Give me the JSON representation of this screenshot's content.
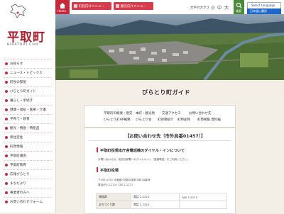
{
  "sidebar": {
    "logo_text": "平取町",
    "logo_sub": "BIRATORI·CHO",
    "items": [
      {
        "label": "お知らせ"
      },
      {
        "label": "ニュース・トピックス"
      },
      {
        "label": "町長の部屋"
      },
      {
        "label": "びらとり町ガイド"
      },
      {
        "label": "暮らし・手続き"
      },
      {
        "label": "健康・福祉・医療・介護"
      },
      {
        "label": "子育て・教育"
      },
      {
        "label": "観光・物産・特産品"
      },
      {
        "label": "移住定住"
      },
      {
        "label": "町政情報"
      },
      {
        "label": "平取町議会"
      },
      {
        "label": "平取町教育"
      },
      {
        "label": "広報びらとり"
      },
      {
        "label": "まちだより"
      },
      {
        "label": "事業者の方へ"
      },
      {
        "label": "お問い合わせフォーム"
      }
    ]
  },
  "header": {
    "home_label": "Home",
    "menu1_label": "町民向けメニュー",
    "menu2_label": "観光向けメニュー",
    "fontsize_label": "文字の大きさ",
    "fs_small": "小",
    "fs_medium": "中",
    "fs_large": "大",
    "search_label": "検索",
    "lang_label": "Select Language",
    "jp_label": "日本語に翻訳"
  },
  "page_title": "びらとり町ガイド",
  "links": {
    "row1": [
      "平取町の概要・歴史",
      "本町・観光地",
      "交通アクセス",
      "お問い合わせ先"
    ],
    "row2": [
      "びらとり町HP戦略",
      "びらとり会",
      "町財務紹介",
      "町特産物",
      "町勢要覧 資料編"
    ]
  },
  "contact": {
    "title": "【お問い合わせ先（市外局番01457）】",
    "section1": "平取町役場本庁舎電話機のダイヤル・インについて",
    "section1_text": "お問い合わせは、各担当部署へのダイヤルイン（直通電話）をご利用ください。",
    "section2": "平取町役場",
    "address1": "〒055-0192 北海道沙流郡平取町本町28番地",
    "address2": "電話(代) 2-2221 FAX 2-2277",
    "table": [
      [
        "総務課",
        "電話 2-2221",
        "FAX 2-2277"
      ],
      [
        "まちづくり課",
        "電話 2-2222",
        ""
      ]
    ]
  },
  "colors": {
    "accent_red": "#c62a3a",
    "search_green": "#4a8b3a",
    "translate_blue": "#1e66c8"
  }
}
